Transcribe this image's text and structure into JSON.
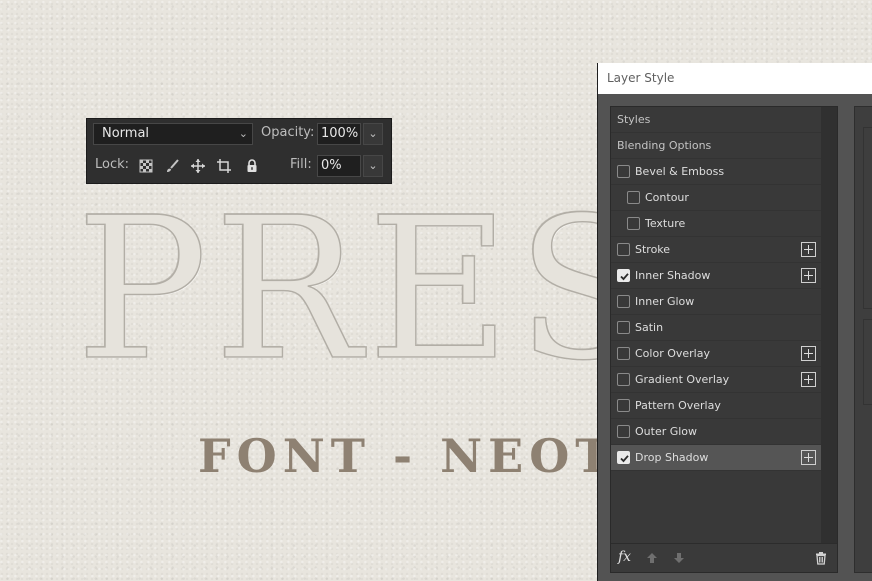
{
  "canvas": {
    "headline_text": "PRES",
    "subtitle_text": "FONT - NEOTH"
  },
  "layers_toolbar": {
    "blend_mode": "Normal",
    "opacity_label": "Opacity:",
    "opacity_value": "100%",
    "lock_label": "Lock:",
    "fill_label": "Fill:",
    "fill_value": "0%",
    "lock_icons": [
      "lock-transparent-pixels-icon",
      "lock-image-pixels-icon",
      "lock-position-icon",
      "lock-artboard-icon",
      "lock-all-icon"
    ]
  },
  "layer_style_dialog": {
    "title": "Layer Style",
    "styles": [
      {
        "label": "Styles",
        "type": "header"
      },
      {
        "label": "Blending Options",
        "type": "header"
      },
      {
        "label": "Bevel & Emboss",
        "checked": false,
        "indent": false,
        "add": false
      },
      {
        "label": "Contour",
        "checked": false,
        "indent": true,
        "add": false
      },
      {
        "label": "Texture",
        "checked": false,
        "indent": true,
        "add": false
      },
      {
        "label": "Stroke",
        "checked": false,
        "indent": false,
        "add": true
      },
      {
        "label": "Inner Shadow",
        "checked": true,
        "indent": false,
        "add": true
      },
      {
        "label": "Inner Glow",
        "checked": false,
        "indent": false,
        "add": false
      },
      {
        "label": "Satin",
        "checked": false,
        "indent": false,
        "add": false
      },
      {
        "label": "Color Overlay",
        "checked": false,
        "indent": false,
        "add": true
      },
      {
        "label": "Gradient Overlay",
        "checked": false,
        "indent": false,
        "add": true
      },
      {
        "label": "Pattern Overlay",
        "checked": false,
        "indent": false,
        "add": false
      },
      {
        "label": "Outer Glow",
        "checked": false,
        "indent": false,
        "add": false
      },
      {
        "label": "Drop Shadow",
        "checked": true,
        "indent": false,
        "add": true,
        "selected": true
      }
    ],
    "footer_icons": [
      "fx-icon",
      "move-up-icon",
      "move-down-icon",
      "trash-icon"
    ],
    "fx_glyph": "fx"
  }
}
